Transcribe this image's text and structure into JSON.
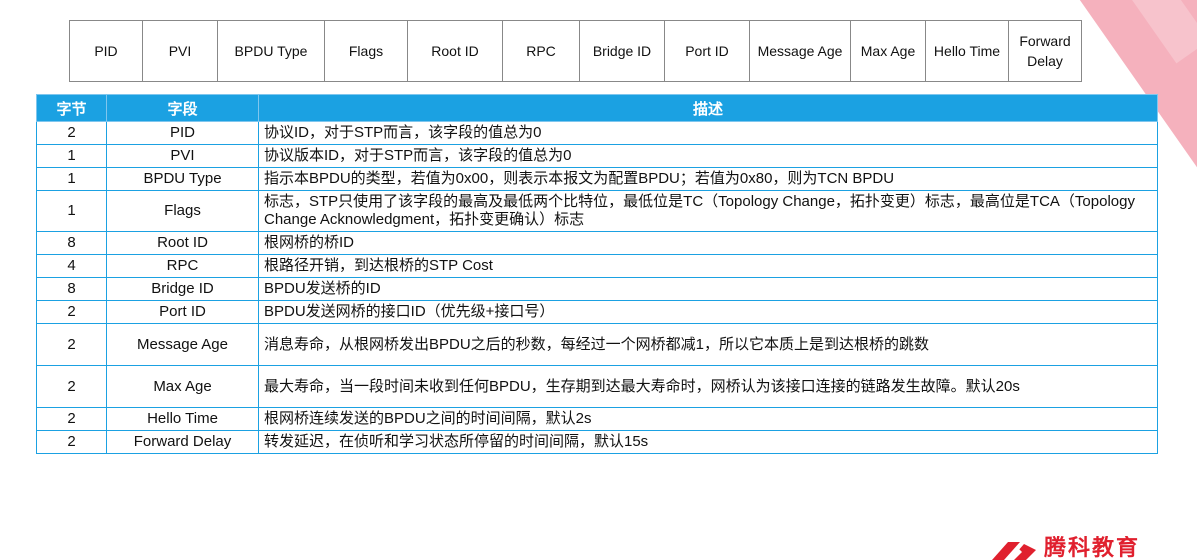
{
  "header_fields": [
    {
      "label": "PID",
      "w": 0
    },
    {
      "label": "PVI"
    },
    {
      "label": "BPDU Type"
    },
    {
      "label": "Flags"
    },
    {
      "label": "Root ID"
    },
    {
      "label": "RPC"
    },
    {
      "label": "Bridge ID"
    },
    {
      "label": "Port ID"
    },
    {
      "label": "Message Age"
    },
    {
      "label": "Max Age"
    },
    {
      "label": "Hello Time"
    },
    {
      "label": "Forward Delay"
    }
  ],
  "table": {
    "columns": [
      "字节",
      "字段",
      "描述"
    ],
    "rows": [
      {
        "bytes": "2",
        "field": "PID",
        "desc": "协议ID，对于STP而言，该字段的值总为0"
      },
      {
        "bytes": "1",
        "field": "PVI",
        "desc": "协议版本ID，对于STP而言，该字段的值总为0"
      },
      {
        "bytes": "1",
        "field": "BPDU Type",
        "desc": "指示本BPDU的类型，若值为0x00，则表示本报文为配置BPDU；若值为0x80，则为TCN BPDU"
      },
      {
        "bytes": "1",
        "field": "Flags",
        "desc": "标志，STP只使用了该字段的最高及最低两个比特位，最低位是TC（Topology Change，拓扑变更）标志，最高位是TCA（Topology Change Acknowledgment，拓扑变更确认）标志"
      },
      {
        "bytes": "8",
        "field": "Root ID",
        "desc": "根网桥的桥ID"
      },
      {
        "bytes": "4",
        "field": "RPC",
        "desc": "根路径开销，到达根桥的STP Cost"
      },
      {
        "bytes": "8",
        "field": "Bridge ID",
        "desc": "BPDU发送桥的ID"
      },
      {
        "bytes": "2",
        "field": "Port ID",
        "desc": "BPDU发送网桥的接口ID（优先级+接口号）"
      },
      {
        "bytes": "2",
        "field": "Message Age",
        "desc": "消息寿命，从根网桥发出BPDU之后的秒数，每经过一个网桥都减1，所以它本质上是到达根桥的跳数"
      },
      {
        "bytes": "2",
        "field": "Max Age",
        "desc": "最大寿命，当一段时间未收到任何BPDU，生存期到达最大寿命时，网桥认为该接口连接的链路发生故障。默认20s"
      },
      {
        "bytes": "2",
        "field": "Hello Time",
        "desc": "根网桥连续发送的BPDU之间的时间间隔，默认2s"
      },
      {
        "bytes": "2",
        "field": "Forward Delay",
        "desc": "转发延迟，在侦听和学习状态所停留的时间间隔，默认15s"
      }
    ]
  },
  "logo": {
    "text": "腾科教育"
  },
  "colors": {
    "header_blue": "#1ba1e2",
    "logo_red": "#e0202e",
    "deco_pink": "#f4a9b6"
  }
}
